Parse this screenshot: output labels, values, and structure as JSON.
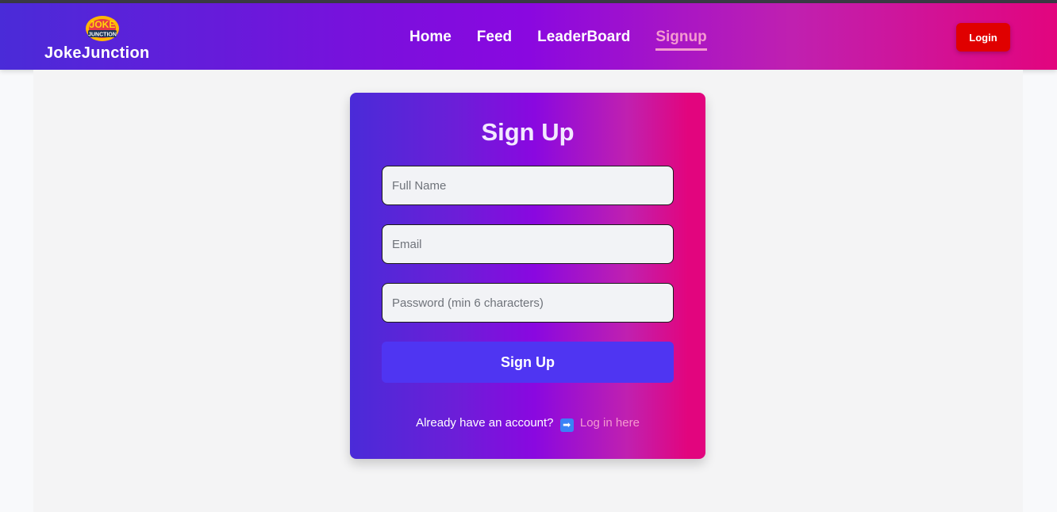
{
  "header": {
    "brand_name": "JokeJunction",
    "logo_text_top": "JOKE",
    "logo_text_bottom": "JUNCTION",
    "nav": [
      {
        "label": "Home",
        "active": false
      },
      {
        "label": "Feed",
        "active": false
      },
      {
        "label": "LeaderBoard",
        "active": false
      },
      {
        "label": "Signup",
        "active": true
      }
    ],
    "login_label": "Login"
  },
  "form": {
    "title": "Sign Up",
    "fields": {
      "full_name": {
        "placeholder": "Full Name",
        "value": ""
      },
      "email": {
        "placeholder": "Email",
        "value": ""
      },
      "password": {
        "placeholder": "Password (min 6 characters)",
        "value": ""
      }
    },
    "submit_label": "Sign Up",
    "footer_prompt": "Already have an account?",
    "footer_icon": "right-arrow-icon",
    "footer_icon_glyph": "➡",
    "footer_link": "Log in here"
  },
  "colors": {
    "gradient_start": "#4a2bd8",
    "gradient_mid": "#8a08e0",
    "gradient_end": "#e2057e",
    "active_link": "#f49ad0",
    "login_button": "#e00000",
    "submit_button": "#4f35f2"
  }
}
